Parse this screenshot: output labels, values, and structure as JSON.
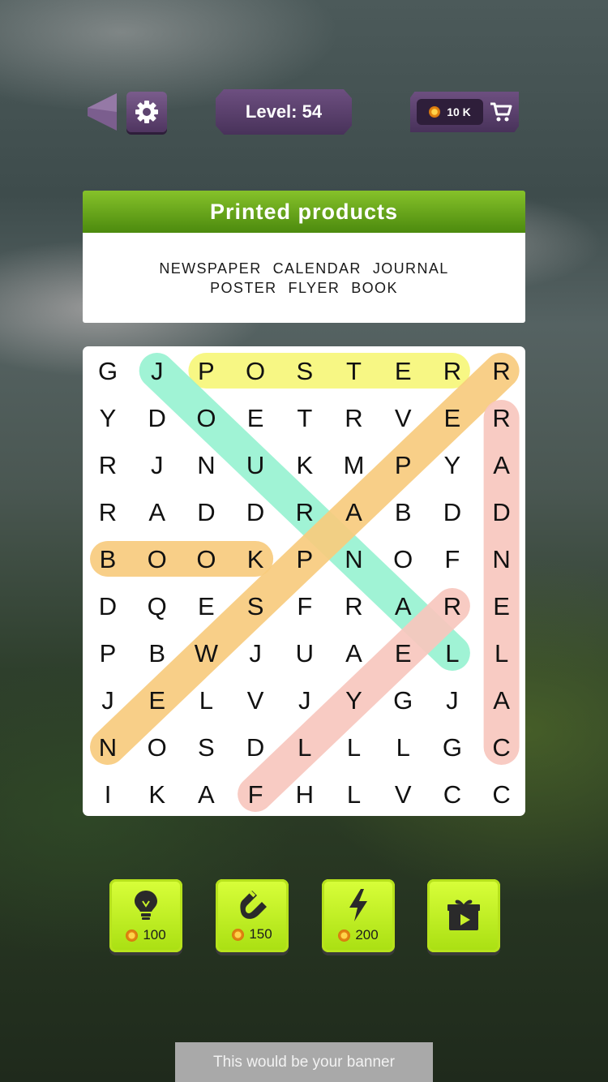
{
  "top_bar": {
    "level_text": "Level: 54",
    "coins": "10 K"
  },
  "category": {
    "title": "Printed products",
    "words_line1": [
      "NEWSPAPER",
      "CALENDAR",
      "JOURNAL"
    ],
    "words_line2": [
      "POSTER",
      "FLYER",
      "BOOK"
    ]
  },
  "grid": {
    "rows": [
      [
        "G",
        "J",
        "P",
        "O",
        "S",
        "T",
        "E",
        "R",
        "R"
      ],
      [
        "Y",
        "D",
        "O",
        "E",
        "T",
        "R",
        "V",
        "E",
        "R"
      ],
      [
        "R",
        "J",
        "N",
        "U",
        "K",
        "M",
        "P",
        "Y",
        "A"
      ],
      [
        "R",
        "A",
        "D",
        "D",
        "R",
        "A",
        "B",
        "D",
        "D"
      ],
      [
        "B",
        "O",
        "O",
        "K",
        "P",
        "N",
        "O",
        "F",
        "N"
      ],
      [
        "D",
        "Q",
        "E",
        "S",
        "F",
        "R",
        "A",
        "R",
        "E"
      ],
      [
        "P",
        "B",
        "W",
        "J",
        "U",
        "A",
        "E",
        "L",
        "L"
      ],
      [
        "J",
        "E",
        "L",
        "V",
        "J",
        "Y",
        "G",
        "J",
        "A"
      ],
      [
        "N",
        "O",
        "S",
        "D",
        "L",
        "L",
        "L",
        "G",
        "C"
      ],
      [
        "I",
        "K",
        "A",
        "F",
        "H",
        "L",
        "V",
        "C",
        "C"
      ]
    ],
    "found_words": [
      {
        "word": "POSTER",
        "from": [
          0,
          2
        ],
        "to": [
          0,
          7
        ],
        "color": "#f7f77a"
      },
      {
        "word": "JOURNAL",
        "from": [
          0,
          1
        ],
        "to": [
          6,
          7
        ],
        "color": "#98f2d2"
      },
      {
        "word": "NEWSPAPER",
        "from": [
          8,
          0
        ],
        "to": [
          0,
          8
        ],
        "color": "#f8cc7e"
      },
      {
        "word": "BOOK",
        "from": [
          4,
          0
        ],
        "to": [
          4,
          3
        ],
        "color": "#f8cc7e"
      },
      {
        "word": "CALENDAR",
        "from": [
          8,
          8
        ],
        "to": [
          1,
          8
        ],
        "color": "#f8c7be"
      },
      {
        "word": "FLYER",
        "from": [
          9,
          3
        ],
        "to": [
          5,
          7
        ],
        "color": "#f8c7be"
      }
    ]
  },
  "powerups": [
    {
      "icon": "lightbulb-icon",
      "cost": "100"
    },
    {
      "icon": "magnet-icon",
      "cost": "150"
    },
    {
      "icon": "lightning-icon",
      "cost": "200"
    },
    {
      "icon": "gift-video-icon",
      "cost": ""
    }
  ],
  "banner": {
    "text": "This would be your banner"
  },
  "colors": {
    "accent_green": "#86c22a",
    "button_purple": "#5e4470",
    "power_lime": "#c8f02a"
  }
}
